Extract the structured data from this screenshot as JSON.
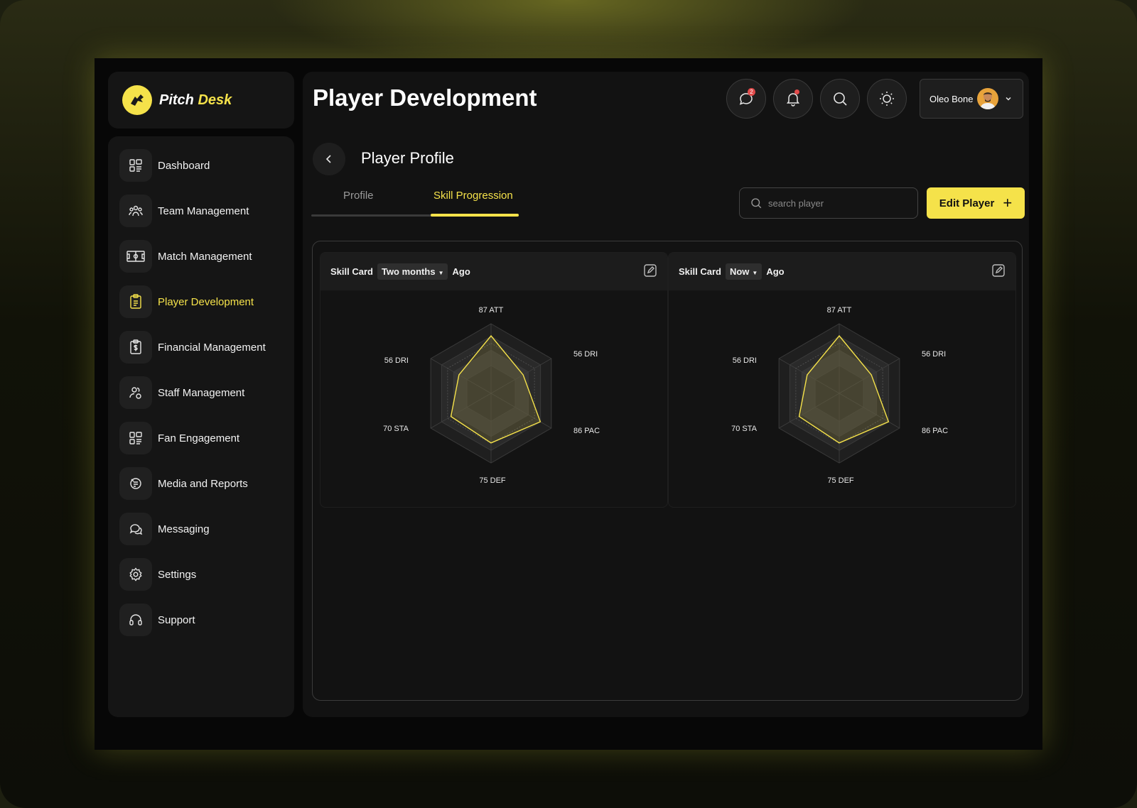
{
  "brand": {
    "name_part1": "Pitch",
    "name_part2": "Desk"
  },
  "sidebar": {
    "items": [
      {
        "label": "Dashboard",
        "icon": "dashboard-icon"
      },
      {
        "label": "Team Management",
        "icon": "team-icon"
      },
      {
        "label": "Match Management",
        "icon": "pitch-icon"
      },
      {
        "label": "Player Development",
        "icon": "clipboard-icon",
        "active": true
      },
      {
        "label": "Financial Management",
        "icon": "finance-icon"
      },
      {
        "label": "Staff Management",
        "icon": "staff-icon"
      },
      {
        "label": "Fan Engagement",
        "icon": "grid-icon"
      },
      {
        "label": "Media and Reports",
        "icon": "media-icon"
      },
      {
        "label": "Messaging",
        "icon": "chat-icon"
      },
      {
        "label": "Settings",
        "icon": "gear-icon"
      },
      {
        "label": "Support",
        "icon": "headset-icon"
      }
    ]
  },
  "header": {
    "title": "Player Development",
    "user_name": "Oleo Bone",
    "message_badge": "2"
  },
  "profile": {
    "title": "Player Profile",
    "tabs": [
      {
        "label": "Profile",
        "active": false
      },
      {
        "label": "Skill Progression",
        "active": true
      }
    ],
    "search_placeholder": "search player",
    "edit_button_label": "Edit Player"
  },
  "cards": [
    {
      "title": "Skill Card",
      "period": "Two months",
      "suffix": "Ago"
    },
    {
      "title": "Skill Card",
      "period": "Now",
      "suffix": "Ago"
    }
  ],
  "chart_data": [
    {
      "type": "radar",
      "axes": [
        "87 ATT",
        "56 DRI",
        "86 PAC",
        "75 DEF",
        "70 STA",
        "56 DRI"
      ],
      "values": [
        87,
        56,
        86,
        75,
        70,
        56
      ],
      "max": 100
    },
    {
      "type": "radar",
      "axes": [
        "87 ATT",
        "56 DRI",
        "86 PAC",
        "75 DEF",
        "70 STA",
        "56 DRI"
      ],
      "values": [
        87,
        56,
        86,
        75,
        70,
        56
      ],
      "max": 100
    }
  ],
  "colors": {
    "accent": "#f5e24a",
    "background": "#121212",
    "badge": "#e24a4a"
  }
}
